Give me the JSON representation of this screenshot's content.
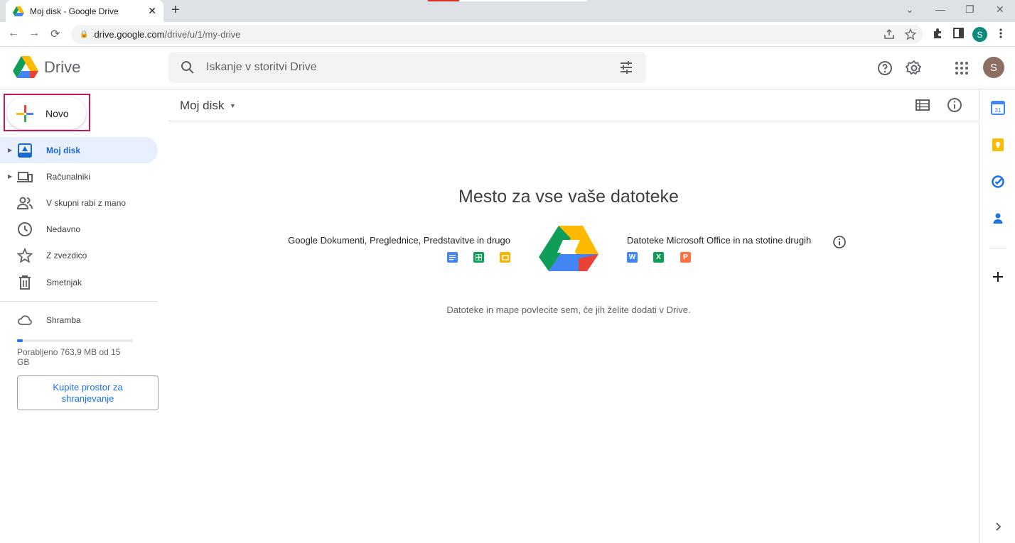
{
  "browser": {
    "tab_title": "Moj disk - Google Drive",
    "tab_close": "✕",
    "new_tab": "+",
    "url_host": "drive.google.com",
    "url_path": "/drive/u/1/my-drive",
    "profile_initial": "S",
    "window_controls": [
      "⌄",
      "—",
      "❐",
      "✕"
    ],
    "nav": [
      "←",
      "→",
      "⟳"
    ],
    "omnibox_icons": [
      "share-icon",
      "star-icon"
    ],
    "toolbar_icons": [
      "extensions-icon",
      "side-panel-icon",
      "menu-icon"
    ]
  },
  "header": {
    "logo_text": "Drive",
    "search_placeholder": "Iskanje v storitvi Drive",
    "avatar_initial": "S",
    "icons": [
      "help-icon",
      "settings-icon",
      "apps-icon"
    ]
  },
  "sidebar": {
    "new_label": "Novo",
    "items": [
      {
        "label": "Moj disk",
        "icon": "my-drive-icon",
        "active": true,
        "expandable": true
      },
      {
        "label": "Računalniki",
        "icon": "computers-icon",
        "active": false,
        "expandable": true
      },
      {
        "label": "V skupni rabi z mano",
        "icon": "shared-icon",
        "active": false,
        "expandable": false
      },
      {
        "label": "Nedavno",
        "icon": "clock-icon",
        "active": false,
        "expandable": false
      },
      {
        "label": "Z zvezdico",
        "icon": "star-icon",
        "active": false,
        "expandable": false
      },
      {
        "label": "Smetnjak",
        "icon": "trash-icon",
        "active": false,
        "expandable": false
      }
    ],
    "storage_label": "Shramba",
    "storage_used_text": "Porabljeno 763,9 MB od 15 GB",
    "storage_fraction": 0.05,
    "buy_label": "Kupite prostor za shranjevanje"
  },
  "main": {
    "breadcrumb": "Moj disk",
    "empty_title": "Mesto za vse vaše datoteke",
    "left_caption": "Google Dokumenti, Preglednice, Predstavitve in drugo",
    "right_caption": "Datoteke Microsoft Office in na stotine drugih",
    "drop_hint": "Datoteke in mape povlecite sem, če jih želite dodati v Drive.",
    "google_apps": [
      {
        "name": "docs-icon",
        "color": "#4285f4"
      },
      {
        "name": "sheets-icon",
        "color": "#0f9d58"
      },
      {
        "name": "slides-icon",
        "color": "#f4b400"
      }
    ],
    "office_apps": [
      {
        "name": "word-icon",
        "letter": "W",
        "color": "#4285f4"
      },
      {
        "name": "excel-icon",
        "letter": "X",
        "color": "#0f9d58"
      },
      {
        "name": "powerpoint-icon",
        "letter": "P",
        "color": "#ff7043"
      }
    ]
  },
  "side_panel": {
    "calendar_day": "31",
    "icons": [
      "calendar-icon",
      "keep-icon",
      "tasks-icon",
      "contacts-icon",
      "add-icon",
      "chevron-right-icon"
    ]
  },
  "colors": {
    "accent": "#1a73e8",
    "active_bg": "#e8f0fe",
    "highlight": "#c2185b"
  }
}
